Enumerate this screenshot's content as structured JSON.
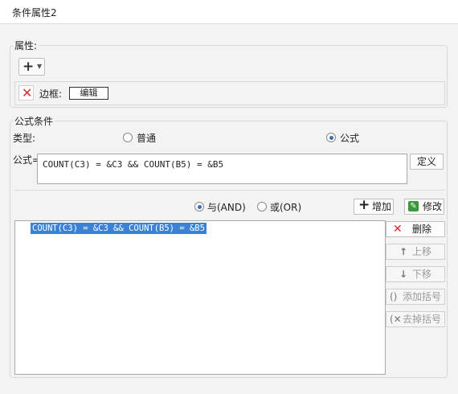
{
  "title": "条件属性2",
  "attributes": {
    "group_label": "属性:",
    "add_icon": "plus-icon",
    "row_label": "边框:",
    "edit_label": "编辑"
  },
  "formula_condition": {
    "group_label": "公式条件",
    "type_label": "类型:",
    "type_options": [
      "普通",
      "公式"
    ],
    "selected_type": "公式",
    "formula_label": "公式=",
    "formula_value": "COUNT(C3) = &C3 && COUNT(B5) = &B5",
    "define_button": "定义",
    "logic_options": [
      "与(AND)",
      "或(OR)"
    ],
    "selected_logic": "与(AND)",
    "add_button": "增加",
    "modify_button": "修改",
    "list_items": [
      "COUNT(C3) = &C3 && COUNT(B5) = &B5"
    ],
    "side_buttons": {
      "delete": "删除",
      "move_up": "上移",
      "move_down": "下移",
      "add_bracket": "添加括号",
      "remove_bracket": "去掉括号"
    }
  },
  "colors": {
    "accent": "#3b82d6",
    "delete_red": "#d9282f",
    "modify_green": "#3a9a3a"
  }
}
